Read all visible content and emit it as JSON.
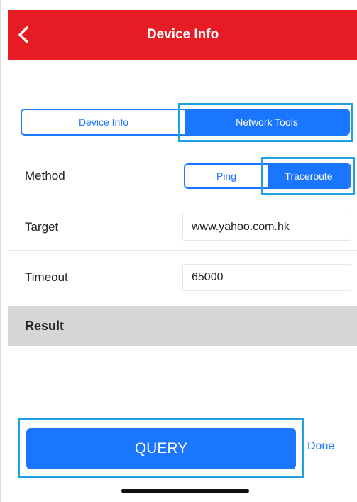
{
  "header": {
    "title": "Device Info",
    "back_icon": "chevron-left-icon",
    "color": "#e61b23"
  },
  "tabs": [
    {
      "label": "Device Info",
      "active": false
    },
    {
      "label": "Network Tools",
      "active": true
    }
  ],
  "method": {
    "label": "Method",
    "options": [
      {
        "label": "Ping",
        "active": false
      },
      {
        "label": "Traceroute",
        "active": true
      }
    ]
  },
  "target": {
    "label": "Target",
    "value": "www.yahoo.com.hk"
  },
  "timeout": {
    "label": "Timeout",
    "value": "65000"
  },
  "result": {
    "label": "Result"
  },
  "actions": {
    "query_label": "QUERY",
    "done_label": "Done"
  },
  "colors": {
    "accent": "#1a75ff",
    "highlight": "#1fa1e0",
    "header": "#e61b23",
    "result_bg": "#d6d6d6"
  }
}
